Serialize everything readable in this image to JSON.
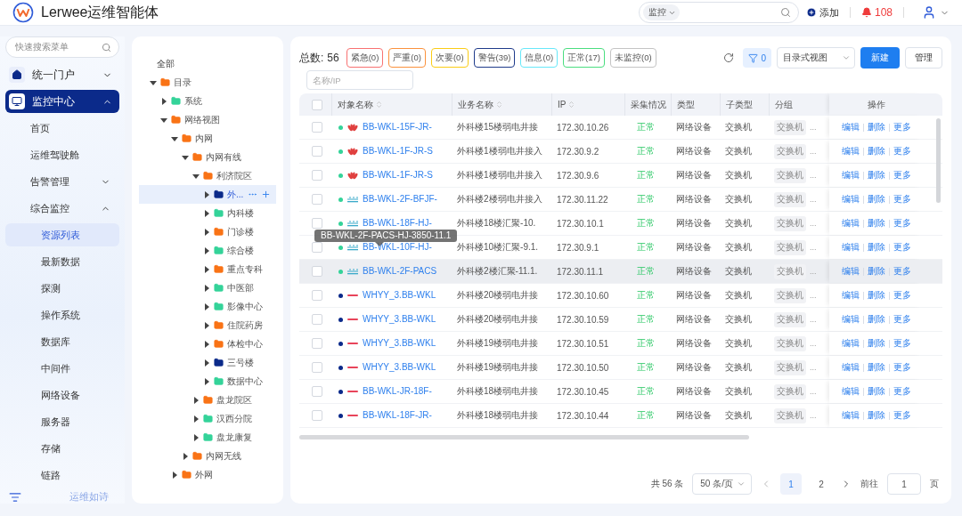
{
  "header": {
    "app_name": "Lerwee运维智能体",
    "search": {
      "scope": "监控"
    },
    "add_label": "添加",
    "alert_count": "108"
  },
  "sidebar": {
    "search_placeholder": "快速搜索菜单",
    "menu": [
      {
        "label": "统一门户",
        "selected": false,
        "expanded": false
      },
      {
        "label": "监控中心",
        "selected": true,
        "expanded": true,
        "children": [
          {
            "label": "首页",
            "selected": false
          },
          {
            "label": "运维驾驶舱",
            "selected": false
          },
          {
            "label": "告警管理",
            "selected": false,
            "expanded": false
          },
          {
            "label": "综合监控",
            "selected": false,
            "expanded": true,
            "children": [
              {
                "label": "资源列表",
                "selected": true
              },
              {
                "label": "最新数据",
                "selected": false
              },
              {
                "label": "探测",
                "selected": false
              },
              {
                "label": "操作系统",
                "selected": false
              },
              {
                "label": "数据库",
                "selected": false
              },
              {
                "label": "中间件",
                "selected": false
              },
              {
                "label": "网络设备",
                "selected": false
              },
              {
                "label": "服务器",
                "selected": false
              },
              {
                "label": "存储",
                "selected": false
              },
              {
                "label": "链路",
                "selected": false
              }
            ]
          }
        ]
      }
    ],
    "footer_label": "运维如诗"
  },
  "tree": {
    "root_label": "全部",
    "nodes": [
      {
        "label": "目录",
        "color": "#f97316",
        "expanded": true,
        "selected": false,
        "children": [
          {
            "label": "系统",
            "color": "#34d399",
            "expanded": false,
            "selected": false
          },
          {
            "label": "网络视图",
            "color": "#f97316",
            "expanded": true,
            "selected": false,
            "children": [
              {
                "label": "内网",
                "color": "#f97316",
                "expanded": true,
                "selected": false,
                "children": [
                  {
                    "label": "内网有线",
                    "color": "#f97316",
                    "expanded": true,
                    "selected": false,
                    "children": [
                      {
                        "label": "利济院区",
                        "color": "#f97316",
                        "expanded": true,
                        "selected": false,
                        "children": [
                          {
                            "label": "外...",
                            "color": "#0b2a8a",
                            "expanded": false,
                            "selected": true
                          },
                          {
                            "label": "内科楼",
                            "color": "#34d399",
                            "expanded": false,
                            "selected": false
                          },
                          {
                            "label": "门诊楼",
                            "color": "#f97316",
                            "expanded": false,
                            "selected": false
                          },
                          {
                            "label": "综合楼",
                            "color": "#34d399",
                            "expanded": false,
                            "selected": false
                          },
                          {
                            "label": "重点专科",
                            "color": "#f97316",
                            "expanded": false,
                            "selected": false
                          },
                          {
                            "label": "中医部",
                            "color": "#34d399",
                            "expanded": false,
                            "selected": false
                          },
                          {
                            "label": "影像中心",
                            "color": "#34d399",
                            "expanded": false,
                            "selected": false
                          },
                          {
                            "label": "住院药房",
                            "color": "#f97316",
                            "expanded": false,
                            "selected": false
                          },
                          {
                            "label": "体检中心",
                            "color": "#f97316",
                            "expanded": false,
                            "selected": false
                          },
                          {
                            "label": "三号楼",
                            "color": "#0b2a8a",
                            "expanded": false,
                            "selected": false
                          },
                          {
                            "label": "数据中心",
                            "color": "#34d399",
                            "expanded": false,
                            "selected": false
                          }
                        ]
                      },
                      {
                        "label": "盘龙院区",
                        "color": "#f97316",
                        "expanded": false,
                        "selected": false
                      },
                      {
                        "label": "汉西分院",
                        "color": "#34d399",
                        "expanded": false,
                        "selected": false
                      },
                      {
                        "label": "盘龙康复",
                        "color": "#34d399",
                        "expanded": false,
                        "selected": false
                      }
                    ]
                  },
                  {
                    "label": "内网无线",
                    "color": "#f97316",
                    "expanded": false,
                    "selected": false
                  }
                ]
              },
              {
                "label": "外网",
                "color": "#f97316",
                "expanded": false,
                "selected": false
              }
            ]
          }
        ]
      }
    ]
  },
  "toolbar": {
    "total_label": "总数:",
    "total": "56",
    "filters": [
      {
        "label": "紧急(0)",
        "color": "#f87171"
      },
      {
        "label": "严重(0)",
        "color": "#fb923c"
      },
      {
        "label": "次要(0)",
        "color": "#facc15"
      },
      {
        "label": "警告(39)",
        "color": "#1e3a8a"
      },
      {
        "label": "信息(0)",
        "color": "#67e8f9"
      },
      {
        "label": "正常(17)",
        "color": "#4ade80"
      },
      {
        "label": "未监控(0)",
        "color": "#c4c4c4"
      }
    ],
    "filter_count": "0",
    "view_select": "目录式视图",
    "new_button": "新建",
    "manage_button": "管理",
    "search_placeholder": "名称/IP"
  },
  "table": {
    "all_checked": false,
    "columns": [
      {
        "label": "对象名称",
        "sortable": true
      },
      {
        "label": "业务名称",
        "sortable": true
      },
      {
        "label": "IP",
        "sortable": true
      },
      {
        "label": "采集情况",
        "sortable": false
      },
      {
        "label": "类型",
        "sortable": false
      },
      {
        "label": "子类型",
        "sortable": false
      },
      {
        "label": "分组",
        "sortable": false
      },
      {
        "label": "操作",
        "sortable": false
      }
    ],
    "rows": [
      {
        "checked": false,
        "highlighted": false,
        "color": "#34d399",
        "kind": "fan",
        "name": "BB-WKL-15F-JR-",
        "business": "外科楼15楼弱电井接",
        "ip": "172.30.10.26",
        "status": "正常",
        "type": "网络设备",
        "subtype": "交换机",
        "group": "交换机",
        "group_more": "...",
        "actions": [
          "编辑",
          "删除",
          "更多"
        ]
      },
      {
        "checked": false,
        "highlighted": false,
        "color": "#34d399",
        "kind": "fan",
        "name": "BB-WKL-1F-JR-S",
        "business": "外科楼1楼弱电井接入",
        "ip": "172.30.9.2",
        "status": "正常",
        "type": "网络设备",
        "subtype": "交换机",
        "group": "交换机",
        "group_more": "...",
        "actions": [
          "编辑",
          "删除",
          "更多"
        ]
      },
      {
        "checked": false,
        "highlighted": false,
        "color": "#34d399",
        "kind": "fan",
        "name": "BB-WKL-1F-JR-S",
        "business": "外科楼1楼弱电井接入",
        "ip": "172.30.9.6",
        "status": "正常",
        "type": "网络设备",
        "subtype": "交换机",
        "group": "交换机",
        "group_more": "...",
        "actions": [
          "编辑",
          "删除",
          "更多"
        ]
      },
      {
        "checked": false,
        "highlighted": false,
        "color": "#34d399",
        "kind": "bars",
        "name": "BB-WKL-2F-BFJF-",
        "business": "外科楼2楼弱电井接入",
        "ip": "172.30.11.22",
        "status": "正常",
        "type": "网络设备",
        "subtype": "交换机",
        "group": "交换机",
        "group_more": "...",
        "actions": [
          "编辑",
          "删除",
          "更多"
        ]
      },
      {
        "checked": false,
        "highlighted": false,
        "color": "#34d399",
        "kind": "bars",
        "name": "BB-WKL-18F-HJ-",
        "business": "外科楼18楼汇聚-10.",
        "ip": "172.30.10.1",
        "status": "正常",
        "type": "网络设备",
        "subtype": "交换机",
        "group": "交换机",
        "group_more": "...",
        "actions": [
          "编辑",
          "删除",
          "更多"
        ]
      },
      {
        "checked": false,
        "highlighted": false,
        "color": "#34d399",
        "kind": "bars",
        "name": "BB-WKL-10F-HJ-",
        "business": "外科楼10楼汇聚-9.1.",
        "ip": "172.30.9.1",
        "status": "正常",
        "type": "网络设备",
        "subtype": "交换机",
        "group": "交换机",
        "group_more": "...",
        "actions": [
          "编辑",
          "删除",
          "更多"
        ]
      },
      {
        "checked": false,
        "highlighted": true,
        "color": "#34d399",
        "kind": "bars",
        "name": "BB-WKL-2F-PACS",
        "business": "外科楼2楼汇聚-11.1.",
        "ip": "172.30.11.1",
        "status": "正常",
        "type": "网络设备",
        "subtype": "交换机",
        "group": "交换机",
        "group_more": "...",
        "actions": [
          "编辑",
          "删除",
          "更多"
        ]
      },
      {
        "checked": false,
        "highlighted": false,
        "color": "#0b2a8a",
        "kind": "dash",
        "name": "WHYY_3.BB-WKL",
        "business": "外科楼20楼弱电井接",
        "ip": "172.30.10.60",
        "status": "正常",
        "type": "网络设备",
        "subtype": "交换机",
        "group": "交换机",
        "group_more": "...",
        "actions": [
          "编辑",
          "删除",
          "更多"
        ]
      },
      {
        "checked": false,
        "highlighted": false,
        "color": "#0b2a8a",
        "kind": "dash",
        "name": "WHYY_3.BB-WKL",
        "business": "外科楼20楼弱电井接",
        "ip": "172.30.10.59",
        "status": "正常",
        "type": "网络设备",
        "subtype": "交换机",
        "group": "交换机",
        "group_more": "...",
        "actions": [
          "编辑",
          "删除",
          "更多"
        ]
      },
      {
        "checked": false,
        "highlighted": false,
        "color": "#0b2a8a",
        "kind": "dash",
        "name": "WHYY_3.BB-WKL",
        "business": "外科楼19楼弱电井接",
        "ip": "172.30.10.51",
        "status": "正常",
        "type": "网络设备",
        "subtype": "交换机",
        "group": "交换机",
        "group_more": "...",
        "actions": [
          "编辑",
          "删除",
          "更多"
        ]
      },
      {
        "checked": false,
        "highlighted": false,
        "color": "#0b2a8a",
        "kind": "dash",
        "name": "WHYY_3.BB-WKL",
        "business": "外科楼19楼弱电井接",
        "ip": "172.30.10.50",
        "status": "正常",
        "type": "网络设备",
        "subtype": "交换机",
        "group": "交换机",
        "group_more": "...",
        "actions": [
          "编辑",
          "删除",
          "更多"
        ]
      },
      {
        "checked": false,
        "highlighted": false,
        "color": "#0b2a8a",
        "kind": "dash",
        "name": "BB-WKL-JR-18F-",
        "business": "外科楼18楼弱电井接",
        "ip": "172.30.10.45",
        "status": "正常",
        "type": "网络设备",
        "subtype": "交换机",
        "group": "交换机",
        "group_more": "...",
        "actions": [
          "编辑",
          "删除",
          "更多"
        ]
      },
      {
        "checked": false,
        "highlighted": false,
        "color": "#0b2a8a",
        "kind": "dash",
        "name": "BB-WKL-18F-JR-",
        "business": "外科楼18楼弱电井接",
        "ip": "172.30.10.44",
        "status": "正常",
        "type": "网络设备",
        "subtype": "交换机",
        "group": "交换机",
        "group_more": "...",
        "actions": [
          "编辑",
          "删除",
          "更多"
        ]
      }
    ],
    "tooltip": "BB-WKL-2F-PACS-HJ-3850-11.1"
  },
  "pagination": {
    "total": "共 56 条",
    "page_size": "50 条/页",
    "pages": [
      {
        "label": "1",
        "selected": true
      },
      {
        "label": "2",
        "selected": false
      }
    ],
    "goto_label": "前往",
    "goto_value": "1",
    "page_label": "页"
  }
}
